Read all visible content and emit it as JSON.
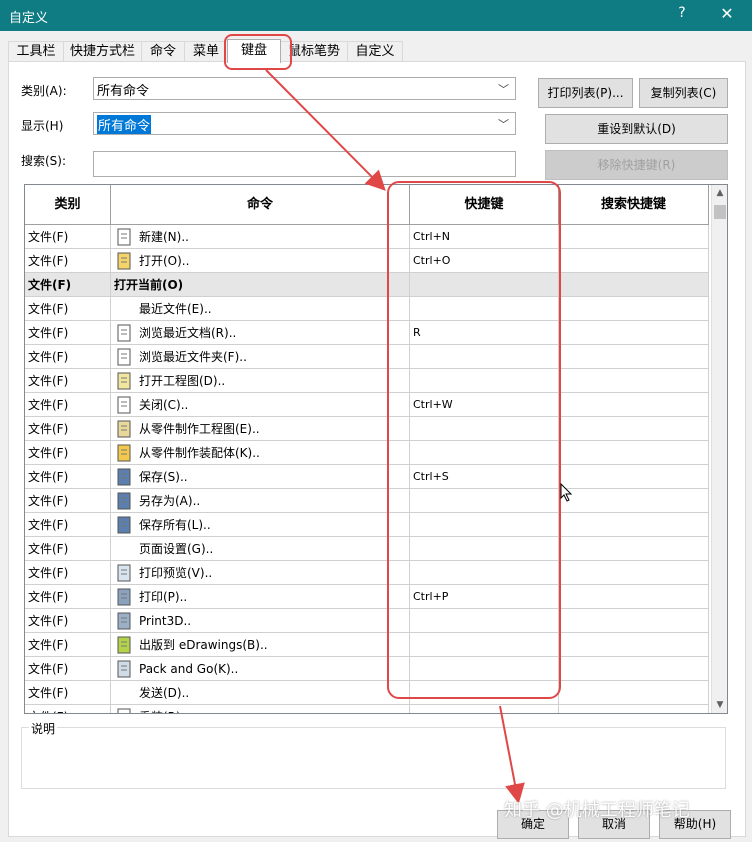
{
  "window": {
    "title": "自定义",
    "help_label": "?",
    "close_label": "✕"
  },
  "tabs": [
    "工具栏",
    "快捷方式栏",
    "命令",
    "菜单",
    "键盘",
    "鼠标笔势",
    "自定义"
  ],
  "filters": {
    "category_label": "类别(A):",
    "category_value": "所有命令",
    "show_label": "显示(H)",
    "show_value": "所有命令",
    "search_label": "搜索(S):",
    "search_value": ""
  },
  "buttons": {
    "print_list": "打印列表(P)...",
    "copy_list": "复制列表(C)",
    "reset_default": "重设到默认(D)",
    "remove_shortcut": "移除快捷键(R)"
  },
  "table": {
    "headers": [
      "类别",
      "命令",
      "快捷键",
      "搜索快捷键"
    ],
    "rows": [
      {
        "category": "文件(F)",
        "command": "新建(N)..",
        "shortcut": "Ctrl+N",
        "search": "",
        "icon": "new-document-icon"
      },
      {
        "category": "文件(F)",
        "command": "打开(O)..",
        "shortcut": "Ctrl+O",
        "search": "",
        "icon": "open-folder-icon"
      },
      {
        "category": "文件(F)",
        "command": "打开当前(O)",
        "shortcut": "",
        "search": "",
        "icon": "",
        "group": true
      },
      {
        "category": "文件(F)",
        "command": "最近文件(E)..",
        "shortcut": "",
        "search": "",
        "icon": ""
      },
      {
        "category": "文件(F)",
        "command": "浏览最近文档(R)..",
        "shortcut": "R",
        "search": "",
        "icon": "recent-documents-icon"
      },
      {
        "category": "文件(F)",
        "command": "浏览最近文件夹(F)..",
        "shortcut": "",
        "search": "",
        "icon": "recent-folders-icon"
      },
      {
        "category": "文件(F)",
        "command": "打开工程图(D)..",
        "shortcut": "",
        "search": "",
        "icon": "open-drawing-icon"
      },
      {
        "category": "文件(F)",
        "command": "关闭(C)..",
        "shortcut": "Ctrl+W",
        "search": "",
        "icon": "close-document-icon"
      },
      {
        "category": "文件(F)",
        "command": "从零件制作工程图(E)..",
        "shortcut": "",
        "search": "",
        "icon": "make-drawing-icon"
      },
      {
        "category": "文件(F)",
        "command": "从零件制作装配体(K)..",
        "shortcut": "",
        "search": "",
        "icon": "make-assembly-icon"
      },
      {
        "category": "文件(F)",
        "command": "保存(S)..",
        "shortcut": "Ctrl+S",
        "search": "",
        "icon": "save-icon"
      },
      {
        "category": "文件(F)",
        "command": "另存为(A)..",
        "shortcut": "",
        "search": "",
        "icon": "save-as-icon"
      },
      {
        "category": "文件(F)",
        "command": "保存所有(L)..",
        "shortcut": "",
        "search": "",
        "icon": "save-all-icon"
      },
      {
        "category": "文件(F)",
        "command": "页面设置(G)..",
        "shortcut": "",
        "search": "",
        "icon": ""
      },
      {
        "category": "文件(F)",
        "command": "打印预览(V)..",
        "shortcut": "",
        "search": "",
        "icon": "print-preview-icon"
      },
      {
        "category": "文件(F)",
        "command": "打印(P)..",
        "shortcut": "Ctrl+P",
        "search": "",
        "icon": "print-icon"
      },
      {
        "category": "文件(F)",
        "command": "Print3D..",
        "shortcut": "",
        "search": "",
        "icon": "print3d-icon"
      },
      {
        "category": "文件(F)",
        "command": "出版到 eDrawings(B)..",
        "shortcut": "",
        "search": "",
        "icon": "edrawings-icon"
      },
      {
        "category": "文件(F)",
        "command": "Pack and Go(K)..",
        "shortcut": "",
        "search": "",
        "icon": "pack-and-go-icon"
      },
      {
        "category": "文件(F)",
        "command": "发送(D)..",
        "shortcut": "",
        "search": "",
        "icon": ""
      },
      {
        "category": "文件(F)",
        "command": "重装(R)..",
        "shortcut": "",
        "search": "",
        "icon": "reload-icon"
      }
    ]
  },
  "description_label": "说明",
  "footer": {
    "ok": "确定",
    "cancel": "取消",
    "help": "帮助(H)"
  },
  "watermark": "知乎 @机械工程师笔记",
  "annotation_color": "#e04848"
}
